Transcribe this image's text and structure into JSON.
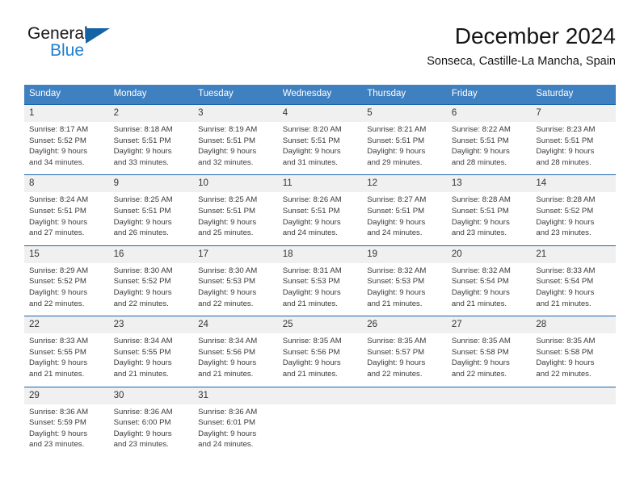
{
  "brand": {
    "name_part1": "General",
    "name_part2": "Blue",
    "logo_icon": "triangle-logo-icon"
  },
  "header": {
    "title": "December 2024",
    "subtitle": "Sonseca, Castille-La Mancha, Spain"
  },
  "colors": {
    "header_blue": "#3f80c0",
    "separator_blue": "#1a66ad",
    "daynum_band": "#f0f0f0",
    "brand_blue": "#1f7fd0",
    "logo_blue": "#1464a5"
  },
  "weekdays": [
    "Sunday",
    "Monday",
    "Tuesday",
    "Wednesday",
    "Thursday",
    "Friday",
    "Saturday"
  ],
  "weeks": [
    [
      {
        "day": "1",
        "sunrise": "Sunrise: 8:17 AM",
        "sunset": "Sunset: 5:52 PM",
        "daylight1": "Daylight: 9 hours",
        "daylight2": "and 34 minutes."
      },
      {
        "day": "2",
        "sunrise": "Sunrise: 8:18 AM",
        "sunset": "Sunset: 5:51 PM",
        "daylight1": "Daylight: 9 hours",
        "daylight2": "and 33 minutes."
      },
      {
        "day": "3",
        "sunrise": "Sunrise: 8:19 AM",
        "sunset": "Sunset: 5:51 PM",
        "daylight1": "Daylight: 9 hours",
        "daylight2": "and 32 minutes."
      },
      {
        "day": "4",
        "sunrise": "Sunrise: 8:20 AM",
        "sunset": "Sunset: 5:51 PM",
        "daylight1": "Daylight: 9 hours",
        "daylight2": "and 31 minutes."
      },
      {
        "day": "5",
        "sunrise": "Sunrise: 8:21 AM",
        "sunset": "Sunset: 5:51 PM",
        "daylight1": "Daylight: 9 hours",
        "daylight2": "and 29 minutes."
      },
      {
        "day": "6",
        "sunrise": "Sunrise: 8:22 AM",
        "sunset": "Sunset: 5:51 PM",
        "daylight1": "Daylight: 9 hours",
        "daylight2": "and 28 minutes."
      },
      {
        "day": "7",
        "sunrise": "Sunrise: 8:23 AM",
        "sunset": "Sunset: 5:51 PM",
        "daylight1": "Daylight: 9 hours",
        "daylight2": "and 28 minutes."
      }
    ],
    [
      {
        "day": "8",
        "sunrise": "Sunrise: 8:24 AM",
        "sunset": "Sunset: 5:51 PM",
        "daylight1": "Daylight: 9 hours",
        "daylight2": "and 27 minutes."
      },
      {
        "day": "9",
        "sunrise": "Sunrise: 8:25 AM",
        "sunset": "Sunset: 5:51 PM",
        "daylight1": "Daylight: 9 hours",
        "daylight2": "and 26 minutes."
      },
      {
        "day": "10",
        "sunrise": "Sunrise: 8:25 AM",
        "sunset": "Sunset: 5:51 PM",
        "daylight1": "Daylight: 9 hours",
        "daylight2": "and 25 minutes."
      },
      {
        "day": "11",
        "sunrise": "Sunrise: 8:26 AM",
        "sunset": "Sunset: 5:51 PM",
        "daylight1": "Daylight: 9 hours",
        "daylight2": "and 24 minutes."
      },
      {
        "day": "12",
        "sunrise": "Sunrise: 8:27 AM",
        "sunset": "Sunset: 5:51 PM",
        "daylight1": "Daylight: 9 hours",
        "daylight2": "and 24 minutes."
      },
      {
        "day": "13",
        "sunrise": "Sunrise: 8:28 AM",
        "sunset": "Sunset: 5:51 PM",
        "daylight1": "Daylight: 9 hours",
        "daylight2": "and 23 minutes."
      },
      {
        "day": "14",
        "sunrise": "Sunrise: 8:28 AM",
        "sunset": "Sunset: 5:52 PM",
        "daylight1": "Daylight: 9 hours",
        "daylight2": "and 23 minutes."
      }
    ],
    [
      {
        "day": "15",
        "sunrise": "Sunrise: 8:29 AM",
        "sunset": "Sunset: 5:52 PM",
        "daylight1": "Daylight: 9 hours",
        "daylight2": "and 22 minutes."
      },
      {
        "day": "16",
        "sunrise": "Sunrise: 8:30 AM",
        "sunset": "Sunset: 5:52 PM",
        "daylight1": "Daylight: 9 hours",
        "daylight2": "and 22 minutes."
      },
      {
        "day": "17",
        "sunrise": "Sunrise: 8:30 AM",
        "sunset": "Sunset: 5:53 PM",
        "daylight1": "Daylight: 9 hours",
        "daylight2": "and 22 minutes."
      },
      {
        "day": "18",
        "sunrise": "Sunrise: 8:31 AM",
        "sunset": "Sunset: 5:53 PM",
        "daylight1": "Daylight: 9 hours",
        "daylight2": "and 21 minutes."
      },
      {
        "day": "19",
        "sunrise": "Sunrise: 8:32 AM",
        "sunset": "Sunset: 5:53 PM",
        "daylight1": "Daylight: 9 hours",
        "daylight2": "and 21 minutes."
      },
      {
        "day": "20",
        "sunrise": "Sunrise: 8:32 AM",
        "sunset": "Sunset: 5:54 PM",
        "daylight1": "Daylight: 9 hours",
        "daylight2": "and 21 minutes."
      },
      {
        "day": "21",
        "sunrise": "Sunrise: 8:33 AM",
        "sunset": "Sunset: 5:54 PM",
        "daylight1": "Daylight: 9 hours",
        "daylight2": "and 21 minutes."
      }
    ],
    [
      {
        "day": "22",
        "sunrise": "Sunrise: 8:33 AM",
        "sunset": "Sunset: 5:55 PM",
        "daylight1": "Daylight: 9 hours",
        "daylight2": "and 21 minutes."
      },
      {
        "day": "23",
        "sunrise": "Sunrise: 8:34 AM",
        "sunset": "Sunset: 5:55 PM",
        "daylight1": "Daylight: 9 hours",
        "daylight2": "and 21 minutes."
      },
      {
        "day": "24",
        "sunrise": "Sunrise: 8:34 AM",
        "sunset": "Sunset: 5:56 PM",
        "daylight1": "Daylight: 9 hours",
        "daylight2": "and 21 minutes."
      },
      {
        "day": "25",
        "sunrise": "Sunrise: 8:35 AM",
        "sunset": "Sunset: 5:56 PM",
        "daylight1": "Daylight: 9 hours",
        "daylight2": "and 21 minutes."
      },
      {
        "day": "26",
        "sunrise": "Sunrise: 8:35 AM",
        "sunset": "Sunset: 5:57 PM",
        "daylight1": "Daylight: 9 hours",
        "daylight2": "and 22 minutes."
      },
      {
        "day": "27",
        "sunrise": "Sunrise: 8:35 AM",
        "sunset": "Sunset: 5:58 PM",
        "daylight1": "Daylight: 9 hours",
        "daylight2": "and 22 minutes."
      },
      {
        "day": "28",
        "sunrise": "Sunrise: 8:35 AM",
        "sunset": "Sunset: 5:58 PM",
        "daylight1": "Daylight: 9 hours",
        "daylight2": "and 22 minutes."
      }
    ],
    [
      {
        "day": "29",
        "sunrise": "Sunrise: 8:36 AM",
        "sunset": "Sunset: 5:59 PM",
        "daylight1": "Daylight: 9 hours",
        "daylight2": "and 23 minutes."
      },
      {
        "day": "30",
        "sunrise": "Sunrise: 8:36 AM",
        "sunset": "Sunset: 6:00 PM",
        "daylight1": "Daylight: 9 hours",
        "daylight2": "and 23 minutes."
      },
      {
        "day": "31",
        "sunrise": "Sunrise: 8:36 AM",
        "sunset": "Sunset: 6:01 PM",
        "daylight1": "Daylight: 9 hours",
        "daylight2": "and 24 minutes."
      },
      {
        "day": "",
        "sunrise": "",
        "sunset": "",
        "daylight1": "",
        "daylight2": ""
      },
      {
        "day": "",
        "sunrise": "",
        "sunset": "",
        "daylight1": "",
        "daylight2": ""
      },
      {
        "day": "",
        "sunrise": "",
        "sunset": "",
        "daylight1": "",
        "daylight2": ""
      },
      {
        "day": "",
        "sunrise": "",
        "sunset": "",
        "daylight1": "",
        "daylight2": ""
      }
    ]
  ]
}
